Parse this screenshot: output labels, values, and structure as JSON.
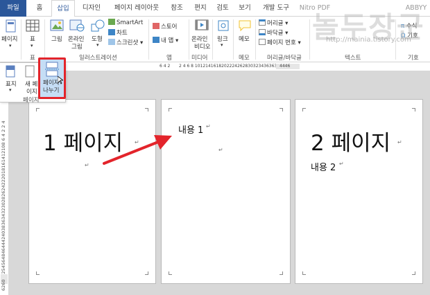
{
  "tabs": [
    "파일",
    "홈",
    "삽입",
    "디자인",
    "페이지 레이아웃",
    "참조",
    "편지",
    "검토",
    "보기",
    "개발 도구",
    "Nitro PDF",
    "ABBYY"
  ],
  "ribbon": {
    "pages_btn": "페이지",
    "table_btn": "표",
    "table_group": "표",
    "picture_btn": "그림",
    "online_picture_btn": "온라인\n그림",
    "online_picture_l1": "온라인",
    "online_picture_l2": "그림",
    "shapes_btn": "도형",
    "smartart": "SmartArt",
    "chart": "차트",
    "screenshot": "스크린샷",
    "illustrations_group": "일러스트레이션",
    "store": "스토어",
    "my_apps": "내 앱",
    "apps_group": "앱",
    "online_video_l1": "온라인",
    "online_video_l2": "비디오",
    "media_group": "미디어",
    "links_btn": "링크",
    "comment_btn": "메모",
    "comment_group": "메모",
    "header": "머리글",
    "footer": "바닥글",
    "page_number": "페이지 번호",
    "header_footer_group": "머리글/바닥글",
    "text_group": "텍스트",
    "equation": "수식",
    "symbol": "기호",
    "symbol_group": "기호"
  },
  "flyout": {
    "cover": "표지",
    "blank_l1": "새 페",
    "blank_l2": "이지",
    "break_l1": "페이지",
    "break_l2": "나누기",
    "group": "페이지"
  },
  "ruler": {
    "top_left": "6 4 2",
    "top_main": "2 4 6 8 10121416182022242628303234363638",
    "top_right": "4446",
    "vertical": "5052545648464442403836343230282624222018161412108 6 4 2   2 4",
    "vertical_bottom": "6260"
  },
  "pages": [
    {
      "big": "1 페이지",
      "mark": "↵"
    },
    {
      "text": "내용 1",
      "mark": "↵"
    },
    {
      "big": "2 페이지",
      "text": "내용 2",
      "mark": "↵"
    }
  ],
  "watermark": {
    "text": "놀두장군",
    "url": "http://mainia.tistory.com"
  },
  "colors": {
    "accent": "#2b579a",
    "highlight": "#e3242b",
    "arrow": "#e3242b"
  }
}
